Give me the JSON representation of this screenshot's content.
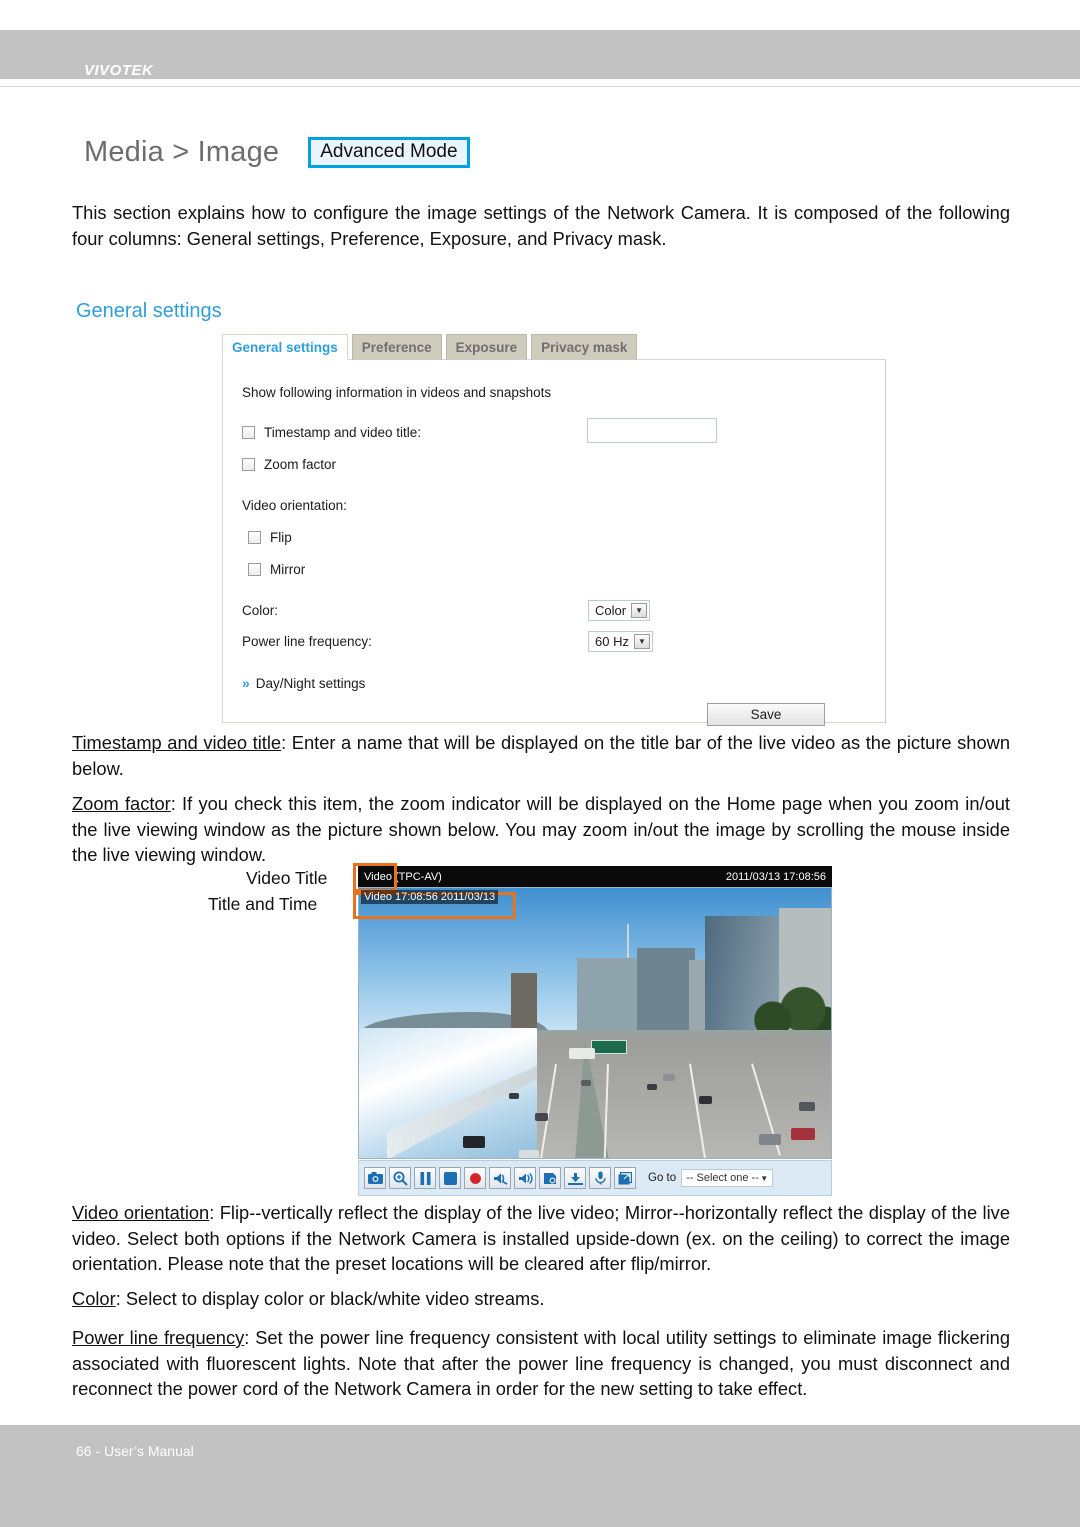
{
  "header": {
    "brand": "VIVOTEK"
  },
  "page": {
    "title": "Media > Image",
    "advanced_mode_label": "Advanced Mode",
    "intro": "This section explains how to configure the image settings of the Network Camera. It is composed of the following four columns: General settings, Preference, Exposure, and Privacy mask.",
    "section_heading": "General settings"
  },
  "panel": {
    "tabs": [
      {
        "label": "General settings",
        "active": true
      },
      {
        "label": "Preference",
        "active": false
      },
      {
        "label": "Exposure",
        "active": false
      },
      {
        "label": "Privacy mask",
        "active": false
      }
    ],
    "show_info_label": "Show following information in videos and snapshots",
    "timestamp_label": "Timestamp and video title:",
    "timestamp_value": "",
    "timestamp_placeholder": "",
    "zoom_factor_label": "Zoom factor",
    "video_orientation_label": "Video orientation:",
    "flip_label": "Flip",
    "mirror_label": "Mirror",
    "color_label": "Color:",
    "color_value": "Color",
    "power_line_label": "Power line frequency:",
    "power_line_value": "60 Hz",
    "day_night_label": "Day/Night settings",
    "save_label": "Save",
    "chevron_glyph": "»",
    "arrow_glyph": "▼"
  },
  "figure": {
    "callout_video_title": "Video Title",
    "callout_title_and_time": "Title and Time",
    "titlebar_left": "Video (TPC-AV)",
    "titlebar_right": "2011/03/13  17:08:56",
    "osd_overlay": "Video 17:08:56  2011/03/13",
    "goto_label": "Go to",
    "goto_value": "-- Select one --",
    "goto_arrow": "▼",
    "toolbar_icons": [
      "snapshot-camera-icon",
      "digital-zoom-icon",
      "pause-icon",
      "stop-icon",
      "record-icon",
      "volume-mute-icon",
      "speaker-icon",
      "talk-icon",
      "receive-audio-icon",
      "microphone-icon",
      "fullscreen-icon"
    ],
    "highlight_color": "#e8731d"
  },
  "descriptions": [
    {
      "lead": "Timestamp and video title",
      "rest": ": Enter a name that will be displayed on the title bar of the live video as the picture shown below."
    },
    {
      "lead": "Zoom factor",
      "rest": ": If you check this item, the zoom indicator will be displayed on the Home page when you zoom in/out the live viewing window as the picture shown below. You may zoom in/out the image by scrolling the mouse inside the live viewing window."
    },
    {
      "lead": "Video orientation",
      "rest": ": Flip--vertically reflect the display of the live video; Mirror--horizontally reflect the display of the live video. Select both options if the Network Camera is installed upside-down (ex. on the ceiling) to correct the image orientation. Please note that the preset locations will be cleared after flip/mirror."
    },
    {
      "lead": "Color",
      "rest": ": Select to display color or black/white video streams."
    },
    {
      "lead": "Power line frequency",
      "rest": ": Set the power line frequency consistent with local utility settings to eliminate image flickering associated with fluorescent lights. Note that after the power line frequency is changed, you must disconnect and reconnect the power cord of the Network Camera in order for the new setting to take effect."
    }
  ],
  "footer": {
    "text": "66 - User’s Manual"
  },
  "colors": {
    "accent_blue": "#2f9fd8",
    "advanced_border": "#00a0e4",
    "band_gray": "#c2c2c2"
  }
}
